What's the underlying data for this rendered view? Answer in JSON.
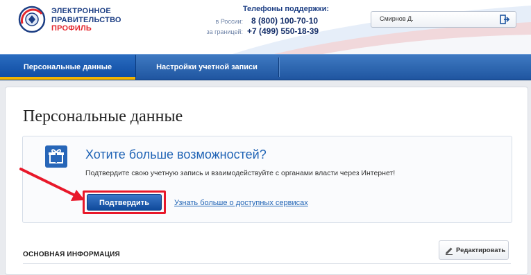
{
  "header": {
    "logo_line1": "ЭЛЕКТРОННОЕ",
    "logo_line2": "ПРАВИТЕЛЬСТВО",
    "logo_line3": "ПРОФИЛЬ",
    "support_title": "Телефоны поддержки:",
    "support_russia_label": "в России:",
    "support_russia_number": "8 (800) 100-70-10",
    "support_abroad_label": "за границей:",
    "support_abroad_number": "+7 (499) 550-18-39",
    "user_name": "Смирнов Д."
  },
  "nav": {
    "tabs": [
      {
        "label": "Персональные данные",
        "active": true
      },
      {
        "label": "Настройки учетной записи",
        "active": false
      }
    ]
  },
  "main": {
    "page_title": "Персональные данные",
    "promo": {
      "title": "Хотите больше возможностей?",
      "text": "Подтвердите свою учетную запись и взаимодействуйте с органами власти через Интернет!",
      "confirm_label": "Подтвердить",
      "learn_more_label": "Узнать больше о доступных сервисах"
    },
    "section_title": "ОСНОВНАЯ ИНФОРМАЦИЯ",
    "edit_label": "Редактировать"
  },
  "colors": {
    "brand_blue": "#1f63b5",
    "nav_blue": "#2a63ad",
    "accent_red": "#e8182a",
    "nav_active_underline": "#f2b400"
  },
  "icons": {
    "logo": "emblem-icon",
    "exit": "exit-icon",
    "gift": "gift-icon",
    "edit": "pencil-icon"
  }
}
